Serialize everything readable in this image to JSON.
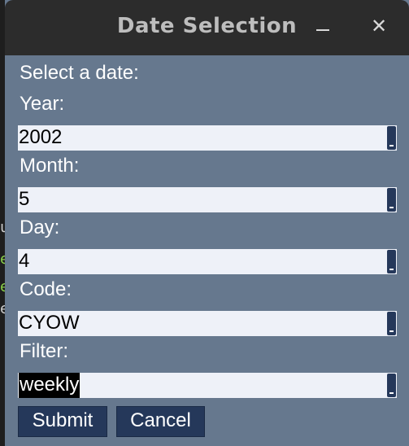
{
  "window": {
    "title": "Date Selection",
    "minimize_glyph": "–",
    "close_glyph": "✕"
  },
  "form": {
    "prompt": "Select a date:",
    "year": {
      "label": "Year:",
      "value": "2002"
    },
    "month": {
      "label": "Month:",
      "value": "5"
    },
    "day": {
      "label": "Day:",
      "value": "4"
    },
    "code": {
      "label": "Code:",
      "value": "CYOW"
    },
    "filter": {
      "label": "Filter:",
      "value": "weekly"
    }
  },
  "buttons": {
    "submit": "Submit",
    "cancel": "Cancel"
  },
  "background_fragments": [
    "u",
    "e",
    "e",
    "e"
  ],
  "colors": {
    "window_bg": "#66788e",
    "titlebar_bg": "#2c2c2c",
    "button_bg": "#25385a",
    "field_bg": "#eef1f8"
  }
}
